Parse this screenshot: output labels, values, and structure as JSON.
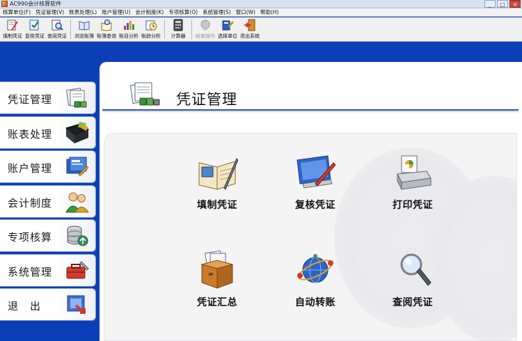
{
  "window": {
    "title": "AC990会计核算软件",
    "controls": [
      "_",
      "□",
      "×"
    ]
  },
  "menu": [
    "核算单位(F)",
    "凭证管理(V)",
    "账表处理(L)",
    "账户管理(U)",
    "会计制度(K)",
    "专项核算(O)",
    "系统管理(S)",
    "窗口(W)",
    "帮助(H)"
  ],
  "toolbar": {
    "buttons": [
      {
        "label": "填制凭证",
        "icon": "pen-document-icon",
        "enabled": true
      },
      {
        "label": "复核凭证",
        "icon": "check-document-icon",
        "enabled": true
      },
      {
        "label": "查阅凭证",
        "icon": "magnifier-document-icon",
        "enabled": true
      },
      {
        "label": "浏览账簿",
        "icon": "book-icon",
        "enabled": true
      },
      {
        "label": "账簿查询",
        "icon": "book-search-icon",
        "enabled": true
      },
      {
        "label": "账目分析",
        "icon": "bar-chart-icon",
        "enabled": true
      },
      {
        "label": "账龄分析",
        "icon": "age-analysis-icon",
        "enabled": true
      },
      {
        "label": "计算器",
        "icon": "calculator-icon",
        "enabled": true
      },
      {
        "label": "结束操作",
        "icon": "stop-icon",
        "enabled": false
      },
      {
        "label": "选择单位",
        "icon": "select-unit-icon",
        "enabled": true
      },
      {
        "label": "退出系统",
        "icon": "exit-door-icon",
        "enabled": true
      }
    ]
  },
  "sidebar": {
    "items": [
      {
        "label": "凭证管理",
        "icon": "voucher-stack-icon"
      },
      {
        "label": "账表处理",
        "icon": "folder-book-icon"
      },
      {
        "label": "账户管理",
        "icon": "account-card-icon"
      },
      {
        "label": "会计制度",
        "icon": "people-icon"
      },
      {
        "label": "专项核算",
        "icon": "database-icon"
      },
      {
        "label": "系统管理",
        "icon": "toolbox-icon"
      },
      {
        "label": "退　出",
        "icon": "exit-icon"
      }
    ]
  },
  "main": {
    "title": "凭证管理",
    "header_icon": "voucher-stack-icon",
    "functions": [
      {
        "label": "填制凭证",
        "icon": "ledger-pen-icon"
      },
      {
        "label": "复核凭证",
        "icon": "monitor-pen-icon"
      },
      {
        "label": "打印凭证",
        "icon": "printer-icon"
      },
      {
        "label": "凭证汇总",
        "icon": "box-documents-icon"
      },
      {
        "label": "自动转账",
        "icon": "globe-transfer-icon"
      },
      {
        "label": "查阅凭证",
        "icon": "magnifier-icon"
      }
    ]
  },
  "colors": {
    "desktop_blue": "#0b3fb8",
    "header_rule": "#2b4f9e",
    "close_red": "#c94a3c"
  }
}
